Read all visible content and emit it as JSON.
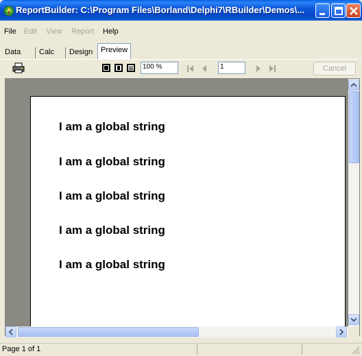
{
  "window": {
    "title": "ReportBuilder: C:\\Program Files\\Borland\\Delphi7\\RBuilder\\Demos\\..."
  },
  "menu": {
    "file": "File",
    "edit": "Edit",
    "view": "View",
    "report": "Report",
    "help": "Help"
  },
  "tabs": [
    {
      "label": "Data"
    },
    {
      "label": "Calc"
    },
    {
      "label": "Design"
    },
    {
      "label": "Preview"
    }
  ],
  "toolbar": {
    "zoom_value": "100 %",
    "page_value": "1",
    "cancel_label": "Cancel"
  },
  "report": {
    "lines": [
      "I am a global string",
      "I am a global string",
      "I am a global string",
      "I am a global string",
      "I am a global string"
    ]
  },
  "status": {
    "page_text": "Page 1 of 1"
  },
  "colors": {
    "titlebar": "#0548c8",
    "background": "#ece9d8",
    "preview_backdrop": "#8a8a82"
  },
  "icons": [
    "app-icon",
    "minimize-icon",
    "maximize-icon",
    "close-icon",
    "print-icon",
    "whole-page-icon",
    "page-width-icon",
    "hundred-percent-icon",
    "first-page-icon",
    "prior-page-icon",
    "next-page-icon",
    "last-page-icon",
    "scroll-up-icon",
    "scroll-down-icon",
    "scroll-left-icon",
    "scroll-right-icon",
    "resize-grip-icon"
  ]
}
